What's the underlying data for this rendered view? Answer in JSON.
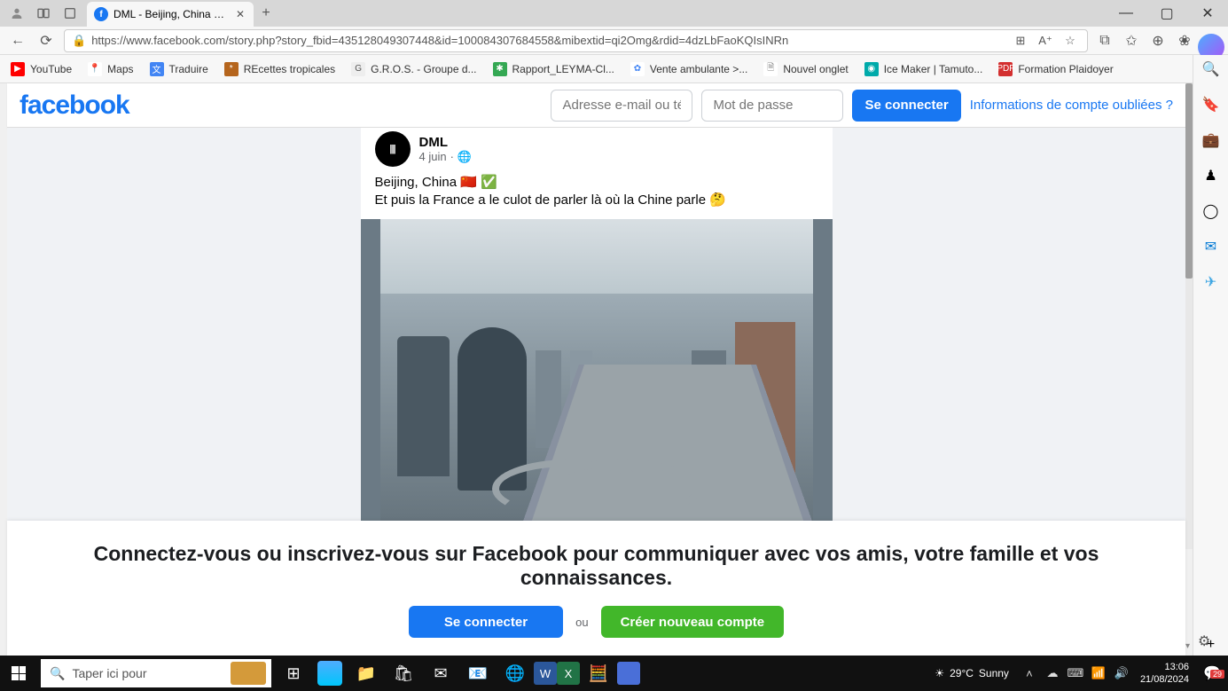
{
  "browser": {
    "tab_title": "DML - Beijing, China ᴄɴ ✅ Et pu...",
    "url": "https://www.facebook.com/story.php?story_fbid=435128049307448&id=100084307684558&mibextid=qi2Omg&rdid=4dzLbFaoKQIsINRn"
  },
  "bookmarks": [
    {
      "label": "YouTube",
      "color": "#ff0000"
    },
    {
      "label": "Maps",
      "color": "#4285f4"
    },
    {
      "label": "Traduire",
      "color": "#4285f4"
    },
    {
      "label": "REcettes tropicales",
      "color": "#b5651d"
    },
    {
      "label": "G.R.O.S. - Groupe d...",
      "color": "#555"
    },
    {
      "label": "Rapport_LEYMA-Cl...",
      "color": "#34a853"
    },
    {
      "label": "Vente ambulante >...",
      "color": "#4285f4"
    },
    {
      "label": "Nouvel onglet",
      "color": "#888"
    },
    {
      "label": "Ice Maker | Tamuto...",
      "color": "#0aa"
    },
    {
      "label": "Formation Plaidoyer",
      "color": "#d32f2f"
    }
  ],
  "facebook": {
    "logo": "facebook",
    "email_placeholder": "Adresse e-mail ou télép",
    "password_placeholder": "Mot de passe",
    "login_btn": "Se connecter",
    "forgot_link": "Informations de compte oubliées ?",
    "post": {
      "author": "DML",
      "date": "4 juin",
      "text_line1": "Beijing, China 🇨🇳 ✅",
      "text_line2": "Et puis la France a le culot de parler là où la Chine parle 🤔"
    },
    "footer": {
      "prompt": "Connectez-vous ou inscrivez-vous sur Facebook pour communiquer avec vos amis, votre famille et vos connaissances.",
      "login_btn": "Se connecter",
      "or": "ou",
      "create_btn": "Créer nouveau compte"
    }
  },
  "taskbar": {
    "search_placeholder": "Taper ici pour",
    "weather_temp": "29°C",
    "weather_cond": "Sunny",
    "time": "13:06",
    "date": "21/08/2024",
    "notif_count": "29"
  }
}
